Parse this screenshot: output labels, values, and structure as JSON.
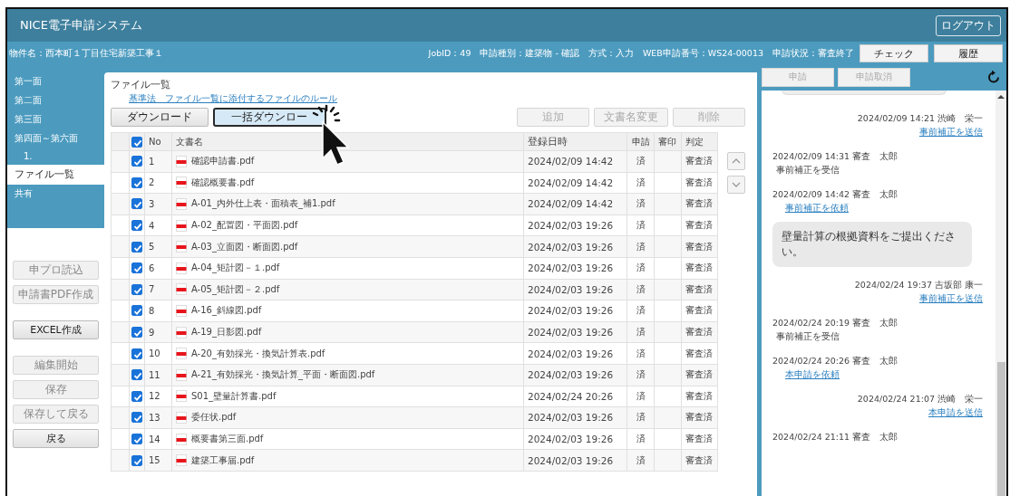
{
  "app": {
    "title": "NICE電子申請システム",
    "logout": "ログアウト"
  },
  "info_bar": {
    "project": "物件名：西本町１丁目住宅新築工事１",
    "details": "JobID：49　申請種別：建築物 - 確認　方式：入力　WEB申請番号：WS24-00013　申請状況：審査終了",
    "buttons": [
      {
        "label": "チェック"
      },
      {
        "label": "履歴"
      }
    ]
  },
  "sidebar": {
    "items": [
      {
        "label": "第一面",
        "selected": false
      },
      {
        "label": "第二面",
        "selected": false
      },
      {
        "label": "第三面",
        "selected": false
      },
      {
        "label": "第四面～第六面",
        "selected": false,
        "children": [
          {
            "label": "1.",
            "selected": false
          }
        ]
      },
      {
        "label": "ファイル一覧",
        "selected": true
      },
      {
        "label": "共有",
        "selected": false
      }
    ]
  },
  "actions": [
    {
      "label": "申プロ読込",
      "disabled": true
    },
    {
      "label": "申請書PDF作成",
      "disabled": true
    },
    {
      "label": "EXCEL作成",
      "disabled": false
    },
    {
      "label": "編集開始",
      "disabled": true
    },
    {
      "label": "保存",
      "disabled": true
    },
    {
      "label": "保存して戻る",
      "disabled": true
    },
    {
      "label": "戻る",
      "disabled": false
    }
  ],
  "file_list": {
    "title": "ファイル一覧",
    "rule_link": "基準法　ファイル一覧に添付するファイルのルール",
    "toolbar_left": [
      {
        "label": "ダウンロード",
        "focused": false
      },
      {
        "label": "一括ダウンロー",
        "focused": true
      }
    ],
    "toolbar_right": [
      {
        "label": "追加",
        "disabled": true
      },
      {
        "label": "文書名変更",
        "disabled": true
      },
      {
        "label": "削除",
        "disabled": true
      }
    ],
    "columns": [
      "No",
      "文書名",
      "登録日時",
      "申請",
      "審印",
      "判定"
    ],
    "all_checked": true,
    "rows": [
      {
        "checked": true,
        "no": "1",
        "name": "確認申請書.pdf",
        "date": "2024/02/09 14:42",
        "applied": "済",
        "stamp": "",
        "judgement": "審査済"
      },
      {
        "checked": true,
        "no": "2",
        "name": "確認概要書.pdf",
        "date": "2024/02/09 14:42",
        "applied": "済",
        "stamp": "",
        "judgement": "審査済"
      },
      {
        "checked": true,
        "no": "3",
        "name": "A-01_内外仕上表・面積表_補1.pdf",
        "date": "2024/02/09 14:42",
        "applied": "済",
        "stamp": "",
        "judgement": "審査済"
      },
      {
        "checked": true,
        "no": "4",
        "name": "A-02_配置図・平面図.pdf",
        "date": "2024/02/03 19:26",
        "applied": "済",
        "stamp": "",
        "judgement": "審査済"
      },
      {
        "checked": true,
        "no": "5",
        "name": "A-03_立面図・断面図.pdf",
        "date": "2024/02/03 19:26",
        "applied": "済",
        "stamp": "",
        "judgement": "審査済"
      },
      {
        "checked": true,
        "no": "6",
        "name": "A-04_矩計図－１.pdf",
        "date": "2024/02/03 19:26",
        "applied": "済",
        "stamp": "",
        "judgement": "審査済"
      },
      {
        "checked": true,
        "no": "7",
        "name": "A-05_矩計図－２.pdf",
        "date": "2024/02/03 19:26",
        "applied": "済",
        "stamp": "",
        "judgement": "審査済"
      },
      {
        "checked": true,
        "no": "8",
        "name": "A-16_斜線図.pdf",
        "date": "2024/02/03 19:26",
        "applied": "済",
        "stamp": "",
        "judgement": "審査済"
      },
      {
        "checked": true,
        "no": "9",
        "name": "A-19_日影図.pdf",
        "date": "2024/02/03 19:26",
        "applied": "済",
        "stamp": "",
        "judgement": "審査済"
      },
      {
        "checked": true,
        "no": "10",
        "name": "A-20_有効採光・換気計算表.pdf",
        "date": "2024/02/03 19:26",
        "applied": "済",
        "stamp": "",
        "judgement": "審査済"
      },
      {
        "checked": true,
        "no": "11",
        "name": "A-21_有効採光・換気計算_平面・断面図.pdf",
        "date": "2024/02/03 19:26",
        "applied": "済",
        "stamp": "",
        "judgement": "審査済"
      },
      {
        "checked": true,
        "no": "12",
        "name": "S01_壁量計算書.pdf",
        "date": "2024/02/24 20:26",
        "applied": "済",
        "stamp": "",
        "judgement": "審査済"
      },
      {
        "checked": true,
        "no": "13",
        "name": "委任状.pdf",
        "date": "2024/02/03 19:26",
        "applied": "済",
        "stamp": "",
        "judgement": "審査済"
      },
      {
        "checked": true,
        "no": "14",
        "name": "概要書第三面.pdf",
        "date": "2024/02/03 19:26",
        "applied": "済",
        "stamp": "",
        "judgement": "審査済"
      },
      {
        "checked": true,
        "no": "15",
        "name": "建築工事届.pdf",
        "date": "2024/02/03 19:26",
        "applied": "済",
        "stamp": "",
        "judgement": "審査済"
      }
    ]
  },
  "timeline": {
    "actions": [
      {
        "label": "申請",
        "disabled": true
      },
      {
        "label": "申請取消",
        "disabled": true
      }
    ],
    "entries": [
      {
        "kind": "sent",
        "header": "2024/02/09 14:21 渋崎　栄一",
        "link": "事前補正を送信"
      },
      {
        "kind": "received",
        "header": "2024/02/09 14:31 審査　太郎",
        "note": "事前補正を受信"
      },
      {
        "kind": "received",
        "header": "2024/02/09 14:42 審査　太郎",
        "link": "事前補正を依頼",
        "message": "壁量計算の根拠資料をご提出ください。"
      },
      {
        "kind": "sent",
        "header": "2024/02/24 19:37 吉坂部 康一",
        "link": "事前補正を送信"
      },
      {
        "kind": "received",
        "header": "2024/02/24 20:19 審査　太郎",
        "note": "事前補正を受信"
      },
      {
        "kind": "received",
        "header": "2024/02/24 20:26 審査　太郎",
        "link": "本申請を依頼"
      },
      {
        "kind": "sent",
        "header": "2024/02/24 21:07 渋崎　栄一",
        "link": "本申請を送信"
      },
      {
        "kind": "received",
        "header": "2024/02/24 21:11 審査　太郎"
      }
    ]
  }
}
